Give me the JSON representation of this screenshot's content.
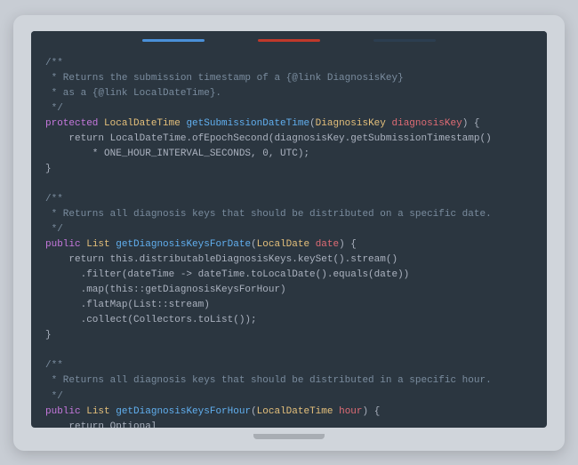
{
  "tabs": [
    {
      "color": "blue"
    },
    {
      "color": "red"
    },
    {
      "color": "dark"
    }
  ],
  "code": {
    "block1": [
      {
        "type": "comment",
        "text": "/**"
      },
      {
        "type": "comment",
        "text": " * Returns the submission timestamp of a {@link DiagnosisKey}"
      },
      {
        "type": "comment",
        "text": " * as a {@link LocalDateTime}."
      },
      {
        "type": "comment",
        "text": " */"
      },
      {
        "type": "mixed",
        "parts": [
          {
            "t": "keyword",
            "v": "protected "
          },
          {
            "t": "type",
            "v": "LocalDateTime "
          },
          {
            "t": "method",
            "v": "getSubmissionDateTime"
          },
          {
            "t": "normal",
            "v": "("
          },
          {
            "t": "type",
            "v": "DiagnosisKey "
          },
          {
            "t": "param",
            "v": "diagnosisKey"
          },
          {
            "t": "normal",
            "v": ") {"
          }
        ]
      },
      {
        "type": "mixed",
        "parts": [
          {
            "t": "normal",
            "v": "    return LocalDateTime.ofEpochSecond(diagnosisKey.getSubmissionTimestamp()"
          }
        ]
      },
      {
        "type": "mixed",
        "parts": [
          {
            "t": "normal",
            "v": "        * ONE_HOUR_INTERVAL_SECONDS, 0, UTC);"
          }
        ]
      },
      {
        "type": "normal",
        "text": "  }"
      }
    ],
    "block2": [
      {
        "type": "comment",
        "text": "/**"
      },
      {
        "type": "comment",
        "text": " * Returns all diagnosis keys that should be distributed on a specific date."
      },
      {
        "type": "comment",
        "text": " */"
      },
      {
        "type": "mixed",
        "parts": [
          {
            "t": "keyword",
            "v": "public "
          },
          {
            "t": "type",
            "v": "List "
          },
          {
            "t": "method",
            "v": "getDiagnosisKeysForDate"
          },
          {
            "t": "normal",
            "v": "("
          },
          {
            "t": "type",
            "v": "LocalDate "
          },
          {
            "t": "param",
            "v": "date"
          },
          {
            "t": "normal",
            "v": ") {"
          }
        ]
      },
      {
        "type": "normal",
        "text": "    return this.distributableDiagnosisKeys.keySet().stream()"
      },
      {
        "type": "normal",
        "text": "      .filter(dateTime -> dateTime.toLocalDate().equals(date))"
      },
      {
        "type": "normal",
        "text": "      .map(this::getDiagnosisKeysForHour)"
      },
      {
        "type": "normal",
        "text": "      .flatMap(List::stream)"
      },
      {
        "type": "normal",
        "text": "      .collect(Collectors.toList());"
      },
      {
        "type": "normal",
        "text": "  }"
      }
    ],
    "block3": [
      {
        "type": "comment",
        "text": "/**"
      },
      {
        "type": "comment",
        "text": " * Returns all diagnosis keys that should be distributed in a specific hour."
      },
      {
        "type": "comment",
        "text": " */"
      },
      {
        "type": "mixed",
        "parts": [
          {
            "t": "keyword",
            "v": "public "
          },
          {
            "t": "type",
            "v": "List "
          },
          {
            "t": "method",
            "v": "getDiagnosisKeysForHour"
          },
          {
            "t": "normal",
            "v": "("
          },
          {
            "t": "type",
            "v": "LocalDateTime "
          },
          {
            "t": "param",
            "v": "hour"
          },
          {
            "t": "normal",
            "v": ") {"
          }
        ]
      },
      {
        "type": "normal",
        "text": "    return Optional"
      }
    ]
  }
}
